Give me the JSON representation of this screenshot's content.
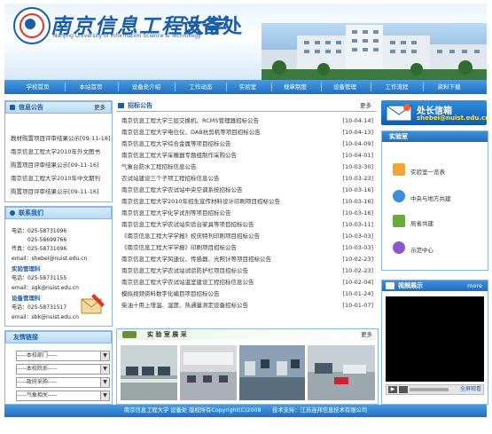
{
  "header": {
    "university_cn": "南京信息工程大学",
    "department": "设备处",
    "university_en": "Nanjing University of Information Science & Technology"
  },
  "nav": {
    "items": [
      "学校首页",
      "本站首页",
      "设备处介绍",
      "工作动态",
      "实验室",
      "规章制度",
      "设备管理",
      "工作流程",
      "资料下载"
    ]
  },
  "notice": {
    "title": "信息公告",
    "more": "更多",
    "items": [
      "教材购置项目评审结果公示[09-11-18]",
      "南京信息工程大学2010年外文图书",
      "购置项目评审结果公示[09-11-16]",
      "南京信息工程大学2010年中文期刊",
      "购置项目评审结果公示[09-11-16]"
    ]
  },
  "contact": {
    "title": "联系我们",
    "lines": [
      "电话：025-58731096",
      "　　　025-58699766",
      "传真：025-58731096",
      "email：shebei@nuist.edu.cn"
    ],
    "dept1": "实验管理科",
    "dept1_lines": [
      "电话：025-58731155",
      "email：sgk@nuist.edu.cn"
    ],
    "dept2": "设备管理科",
    "dept2_lines": [
      "电话：025-58731517",
      "email：sbk@nuist.edu.cn"
    ]
  },
  "links": {
    "title": "友情链接",
    "selects": [
      "-----本校部门-----",
      "-----本校院系-----",
      "-----政府采购-----",
      "-----气象相关-----"
    ]
  },
  "bid": {
    "title": "招标公告",
    "more": "更多",
    "rows": [
      {
        "t": "南京信息工程大学三层交换机、RCMS管理器招标公告",
        "d": "[10-04-14]"
      },
      {
        "t": "南京信息工程大学电位仪、DAB抗剪机等项目招标公告",
        "d": "[10-04-13]"
      },
      {
        "t": "南京信息工程大学综合金属等项目招标公告",
        "d": "[10-04-09]"
      },
      {
        "t": "南京信息工程大学采暖器专题组制作采购公告",
        "d": "[10-04-01]"
      },
      {
        "t": "气象台防水工程招标信息公告",
        "d": "[10-03-30]"
      },
      {
        "t": "农试站建设三个子项工程招标信息公告",
        "d": "[10-03-23]"
      },
      {
        "t": "南京信息工程大学农试站中央空调系统招标公告",
        "d": "[10-03-16]"
      },
      {
        "t": "南京信息工程大学2010年招生宣传材料设计印刷项目招标公告",
        "d": "[10-03-16]"
      },
      {
        "t": "南京信息工程大学化学试剂等项目招标公告",
        "d": "[10-03-16]"
      },
      {
        "t": "南京信息工程大学农试站实验台家具等项目招标公告",
        "d": "[10-03-11]"
      },
      {
        "t": "《南京信息工程大学学报》校庆特刊印刷项目招标公告",
        "d": "[10-03-03]"
      },
      {
        "t": "《南京信息工程大学学报》印刷项目招标公告",
        "d": "[10-03-03]"
      },
      {
        "t": "南京信息工程大学风速仪、传感器、光照计等项目招标公告",
        "d": "[10-02-23]"
      },
      {
        "t": "南京信息工程大学农试站试验防护栏项目招标公告",
        "d": "[10-02-23]"
      },
      {
        "t": "南京信息工程大学农试站温室建设工程招标信息公告",
        "d": "[10-02-04]"
      },
      {
        "t": "模拟视频资料数字化编目项目招标公告",
        "d": "[10-01-24]"
      },
      {
        "t": "柴油十用上增温、湿度、热通量测定设备招标公告",
        "d": "[10-01-07]"
      }
    ]
  },
  "labshow": {
    "title": "实 验 室 展 采",
    "more": "更多"
  },
  "mail": {
    "title": "处长信箱",
    "address": "shebei@nuist.edu.cn"
  },
  "labbox": {
    "title": "实验室",
    "items": [
      "实验室一览表",
      "中央与地方共建",
      "局省共建",
      "示范中心"
    ]
  },
  "video": {
    "title": "视频展示",
    "more": "more",
    "fullscreen": "全屏观看"
  },
  "footer": {
    "text": "南京信息工程大学 设备处 版权所有Copyright(C)2008　　技术支持：江苏连邦信息技术有限公司"
  },
  "colors": {
    "primary": "#1a5da8",
    "nav": "#1f6fc0",
    "border": "#8ab8e0",
    "accent": "#ffe14a"
  }
}
